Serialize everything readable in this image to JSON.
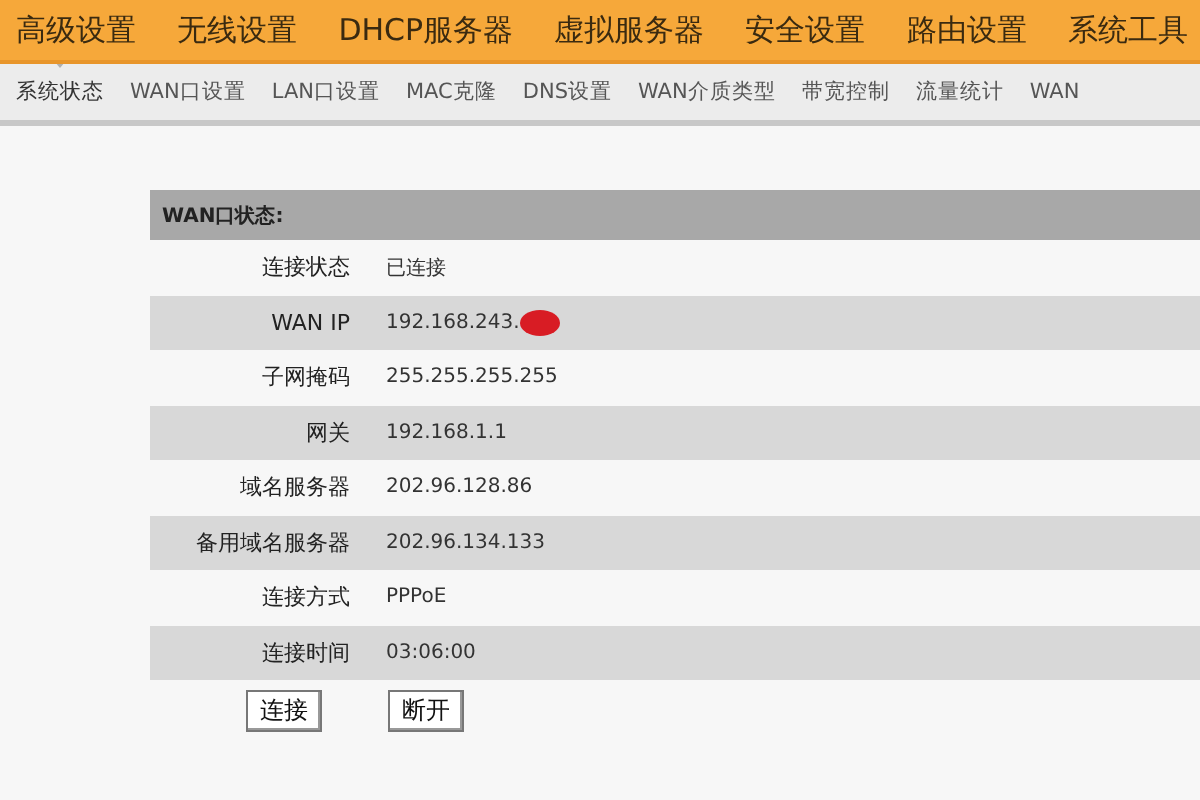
{
  "menu": [
    {
      "label": "高级设置"
    },
    {
      "label": "无线设置"
    },
    {
      "label": "DHCP服务器"
    },
    {
      "label": "虚拟服务器"
    },
    {
      "label": "安全设置"
    },
    {
      "label": "路由设置"
    },
    {
      "label": "系统工具"
    }
  ],
  "tabs": [
    {
      "label": "系统状态",
      "selected": true
    },
    {
      "label": "WAN口设置",
      "selected": false
    },
    {
      "label": "LAN口设置",
      "selected": false
    },
    {
      "label": "MAC克隆",
      "selected": false
    },
    {
      "label": "DNS设置",
      "selected": false
    },
    {
      "label": "WAN介质类型",
      "selected": false
    },
    {
      "label": "带宽控制",
      "selected": false
    },
    {
      "label": "流量统计",
      "selected": false
    },
    {
      "label": "WAN",
      "selected": false
    }
  ],
  "panel": {
    "title": "WAN口状态:",
    "rows": [
      {
        "label": "连接状态",
        "value": "已连接"
      },
      {
        "label": "WAN IP",
        "value": "192.168.243.",
        "redacted": true
      },
      {
        "label": "子网掩码",
        "value": "255.255.255.255"
      },
      {
        "label": "网关",
        "value": "192.168.1.1"
      },
      {
        "label": "域名服务器",
        "value": "202.96.128.86"
      },
      {
        "label": "备用域名服务器",
        "value": "202.96.134.133"
      },
      {
        "label": "连接方式",
        "value": "PPPoE"
      },
      {
        "label": "连接时间",
        "value": "03:06:00"
      }
    ]
  },
  "buttons": [
    "连接",
    "断开"
  ]
}
